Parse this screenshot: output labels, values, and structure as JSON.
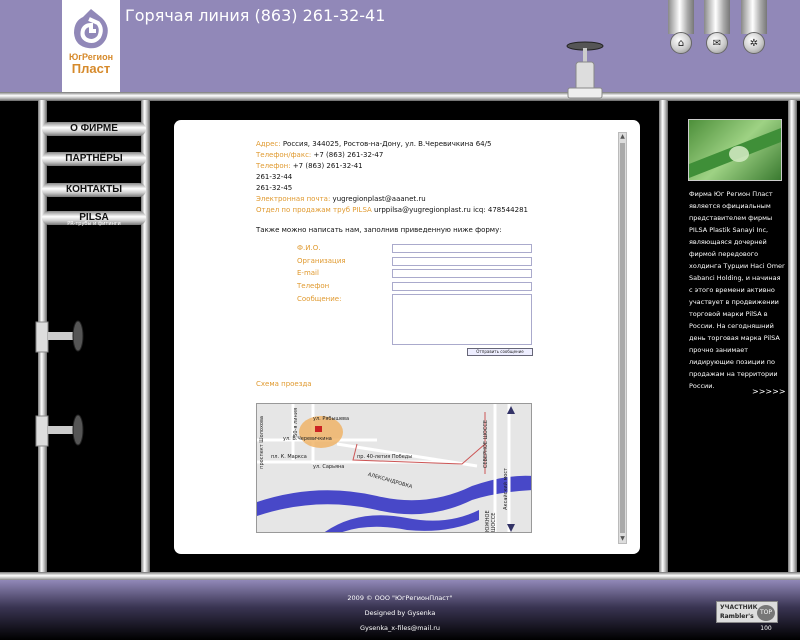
{
  "header": {
    "hotline": "Горячая линия (863) 261-32-41",
    "logo_line1": "ЮгРегион",
    "logo_line2": "Пласт",
    "buttons": [
      {
        "name": "home-icon",
        "glyph": "⌂"
      },
      {
        "name": "mail-icon",
        "glyph": "✉"
      },
      {
        "name": "sitemap-icon",
        "glyph": "✲"
      }
    ]
  },
  "menu": {
    "items": [
      "О ФИРМЕ",
      "ПАРТНЁРЫ",
      "КОНТАКТЫ",
      "PILSA"
    ],
    "pilsa_sub": "PR-трубы и фитинги"
  },
  "contacts": {
    "address_label": "Адрес:",
    "address": "Россия, 344025, Ростов-на-Дону, ул. В.Черевичкина 64/5",
    "fax_label": "Телефон/факс:",
    "fax": "+7 (863) 261-32-47",
    "phone_label": "Телефон:",
    "phone": "+7 (863) 261-32-41",
    "phone2": "261-32-44",
    "phone3": "261-32-45",
    "email_label": "Электронная почта:",
    "email": "yugregionplast@aaanet.ru",
    "sales_label": "Отдел по продажам труб PILSA",
    "sales": "urppilsa@yugregionplast.ru icq: 478544281"
  },
  "form": {
    "intro": "Также можно написать нам, заполнив приведенную ниже форму:",
    "fields": [
      "Ф.И.О.",
      "Организация",
      "E-mail",
      "Телефон",
      "Сообщение:"
    ],
    "submit": "Отправить сообщение"
  },
  "map": {
    "title": "Схема проезда",
    "labels": [
      "ул. Рябышева",
      "ул. В.Черевичкина",
      "пр. 40-летия Победы",
      "пл. К. Маркса",
      "ул. Сарьяна",
      "АЛЕКСАНДРОВКА",
      "СЕВЕРНОЕ ШОССЕ",
      "ЮЖНОЕ ШОССЕ",
      "Аксайский мост",
      "50-я линия",
      "проспект Шолохова"
    ]
  },
  "sidebar": {
    "text": "Фирма Юг Регион Пласт является официальным представителем фирмы PILSA Plastik Sanayi Inc, являющаяся дочерней фирмой передового холдинга Турции Haci Omer Sabanci Holding, и начиная с этого времени активно участвует в продвижении торговой марки PilSA в России. На сегодняшний день торговая марка PilSA прочно занимает лидирующие позиции по продажам на территории России.",
    "more": ">>>>>"
  },
  "footer": {
    "copyright": "2009 © ООО \"ЮгРегионПласт\"",
    "designed": "Designed by Gysenka",
    "email": "Gysenka_x-files@mail.ru",
    "counter_top": "УЧАСТНИК",
    "counter_name": "Rambler's",
    "counter_badge": "TOP 100"
  },
  "colors": {
    "accent": "#e09a30",
    "header": "#9188b8",
    "water": "#4848c8"
  }
}
